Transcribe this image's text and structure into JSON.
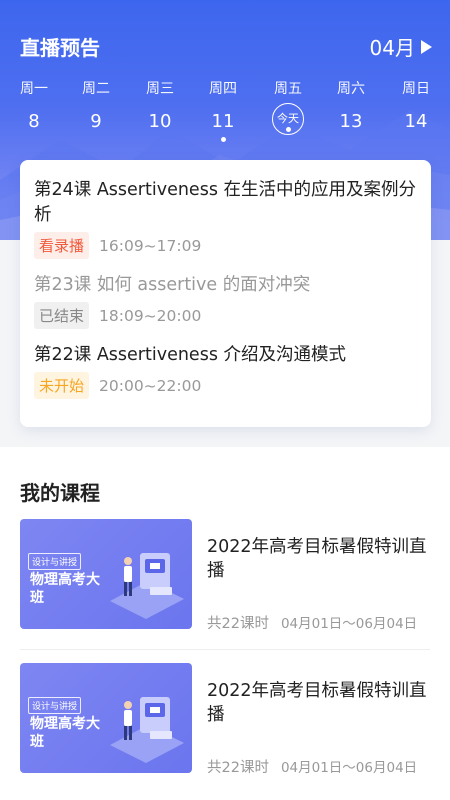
{
  "header": {
    "title": "直播预告",
    "month": "04月"
  },
  "week": [
    {
      "weekday": "周一",
      "date": "8",
      "has_event": false
    },
    {
      "weekday": "周二",
      "date": "9",
      "has_event": false
    },
    {
      "weekday": "周三",
      "date": "10",
      "has_event": false
    },
    {
      "weekday": "周四",
      "date": "11",
      "has_event": true
    },
    {
      "weekday": "周五",
      "date": "今天",
      "has_event": true,
      "is_today": true
    },
    {
      "weekday": "周六",
      "date": "13",
      "has_event": false
    },
    {
      "weekday": "周日",
      "date": "14",
      "has_event": false
    }
  ],
  "schedule": [
    {
      "title": "第24课 Assertiveness 在生活中的应用及案例分析",
      "status": "看录播",
      "time": "16:09~17:09",
      "state": "replay"
    },
    {
      "title": "第23课 如何 assertive 的面对冲突",
      "status": "已结束",
      "time": "18:09~20:00",
      "state": "ended"
    },
    {
      "title": "第22课 Assertiveness 介绍及沟通模式",
      "status": "未开始",
      "time": "20:00~22:00",
      "state": "upcoming"
    }
  ],
  "courses": {
    "heading": "我的课程",
    "items": [
      {
        "thumb_tag": "设计与讲授",
        "thumb_subject": "物理高考大班",
        "title": "2022年高考目标暑假特训直播",
        "lessons": "共22课时",
        "dates": "04月01日～06月04日"
      },
      {
        "thumb_tag": "设计与讲授",
        "thumb_subject": "物理高考大班",
        "title": "2022年高考目标暑假特训直播",
        "lessons": "共22课时",
        "dates": "04月01日～06月04日"
      }
    ]
  },
  "colors": {
    "brand_blue": "#3d66ee",
    "replay_red": "#f25a3c",
    "upcoming_orange": "#f5a623"
  }
}
